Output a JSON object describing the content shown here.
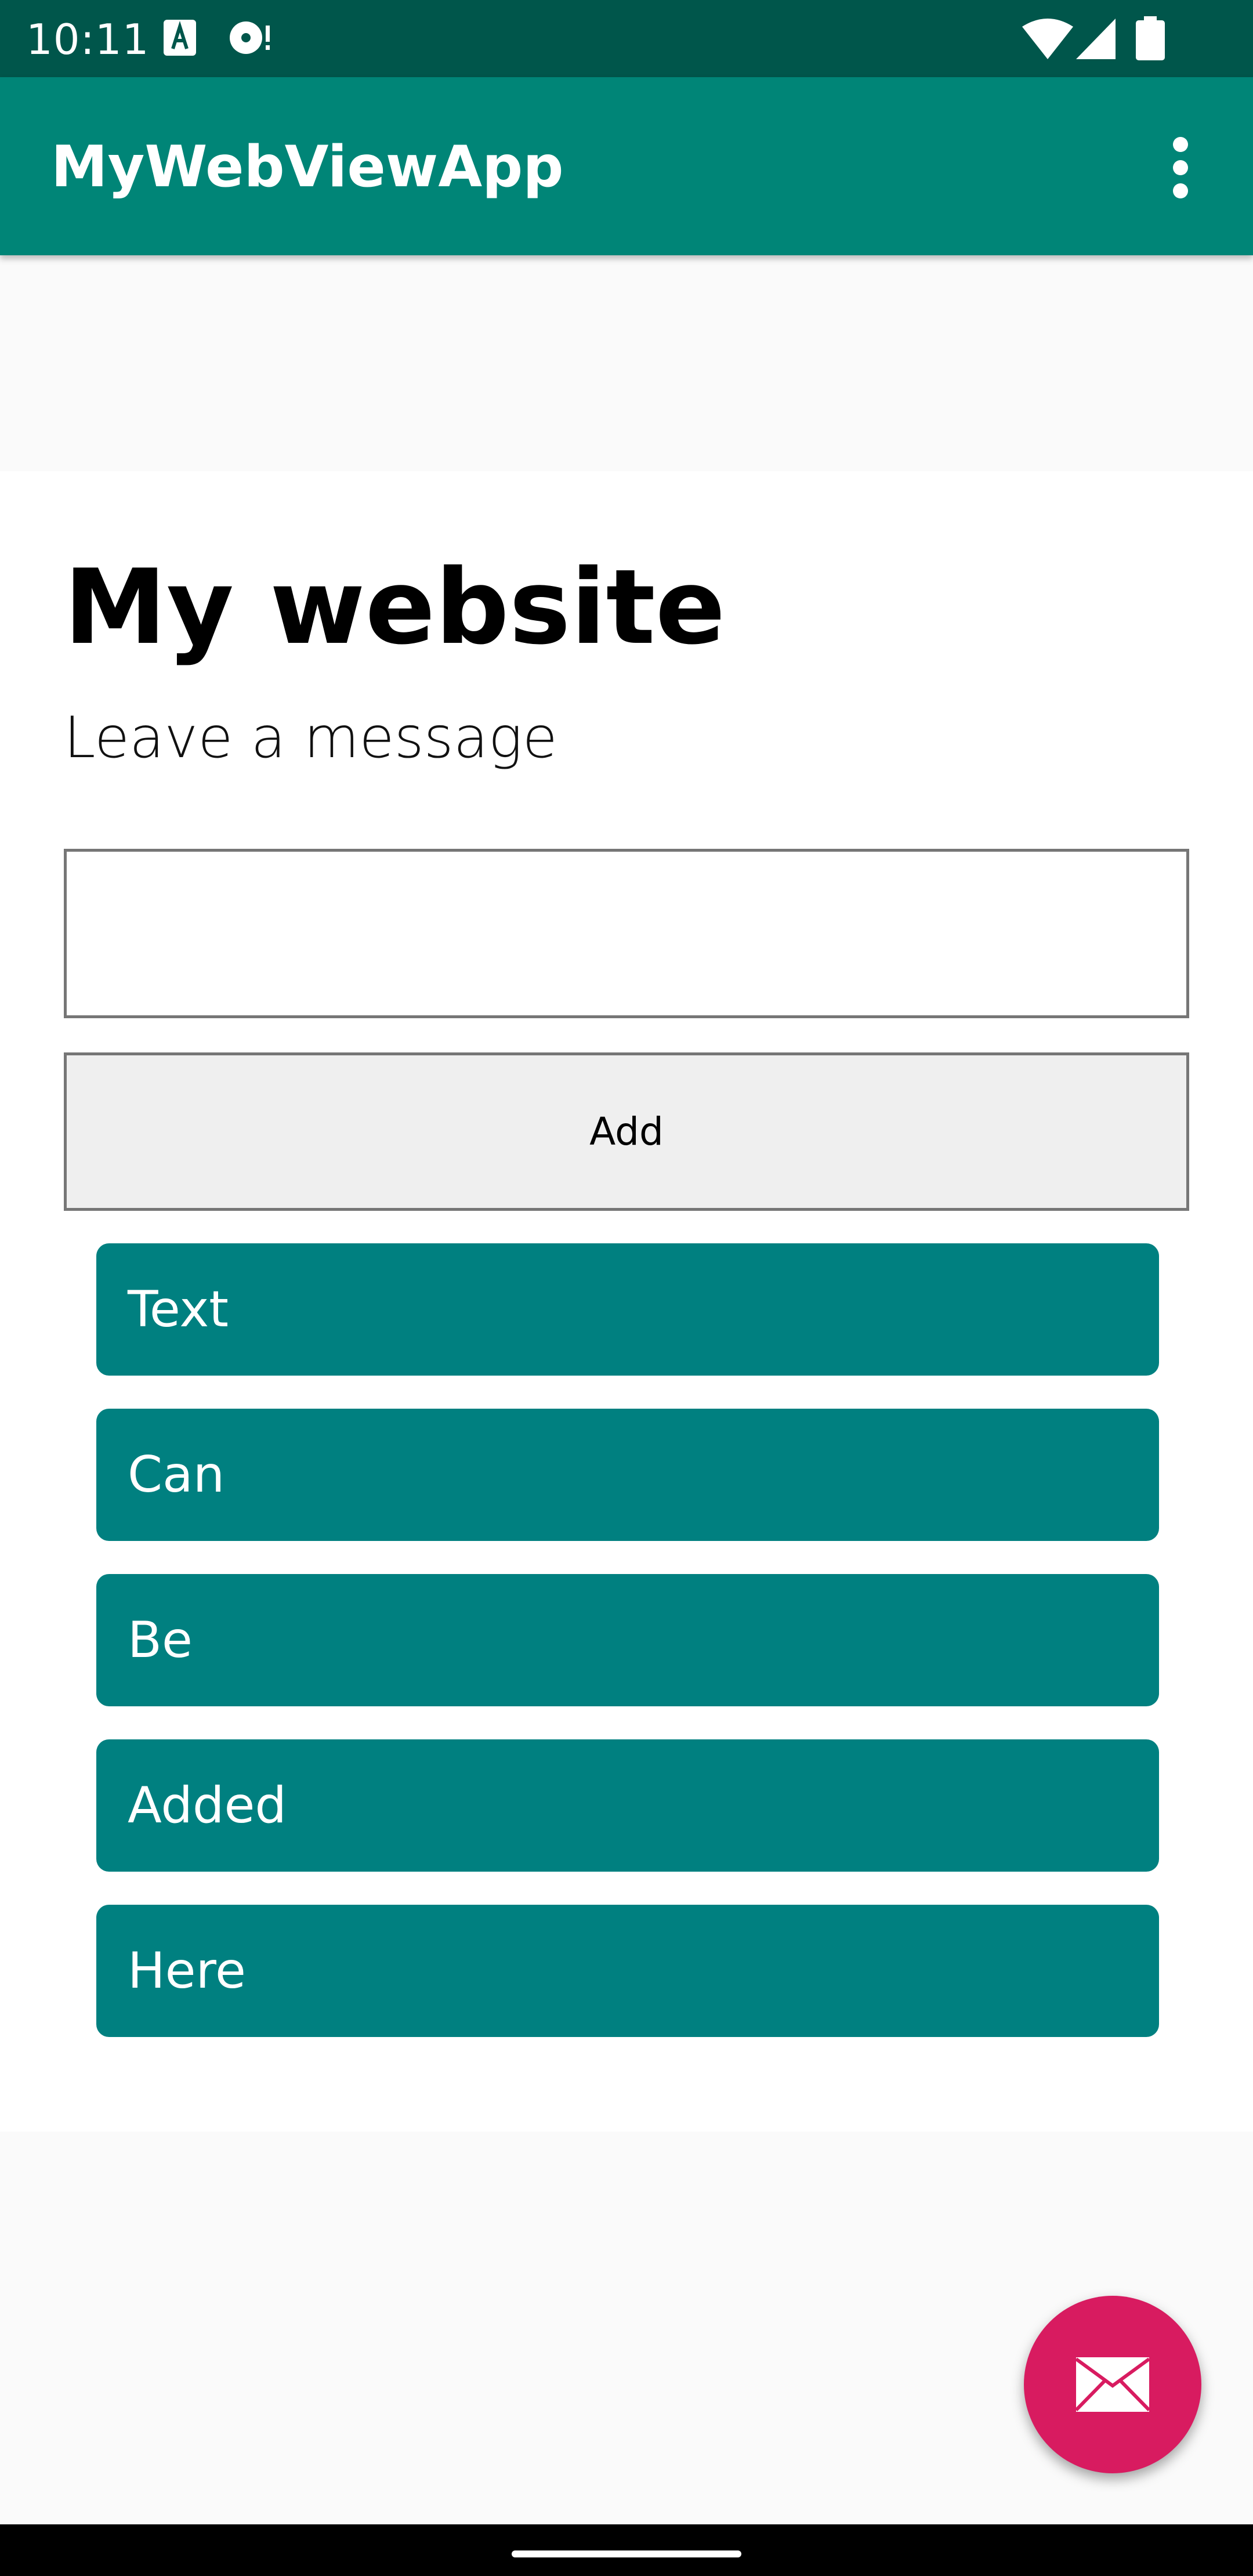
{
  "status_bar": {
    "time": "10:11",
    "icons": [
      "a-icon",
      "disc-icon",
      "wifi-icon",
      "signal-icon",
      "battery-icon"
    ]
  },
  "app_bar": {
    "title": "MyWebViewApp",
    "menu_icon": "more-vert-icon"
  },
  "page": {
    "heading": "My website",
    "subheading": "Leave a message",
    "input": {
      "value": "",
      "placeholder": ""
    },
    "add_button_label": "Add",
    "messages": [
      "Text",
      "Can",
      "Be",
      "Added",
      "Here"
    ]
  },
  "fab": {
    "icon": "email-icon"
  },
  "colors": {
    "status_bar": "#00564b",
    "app_bar": "#008577",
    "message_item": "#008080",
    "fab": "#d81b60",
    "add_button": "#efefef"
  }
}
